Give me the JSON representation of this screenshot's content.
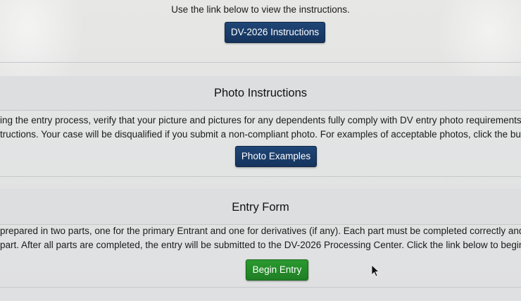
{
  "top_section": {
    "instruction_text": "Use the link below to view the instructions.",
    "button_label": "DV-2026 Instructions"
  },
  "photo_section": {
    "heading": "Photo Instructions",
    "line1": "ing the entry process, verify that your picture and pictures for any dependents fully comply with DV entry photo requirements incluc",
    "line2": "tructions.  Your case will be disqualified if you submit a non-compliant photo.  For examples of acceptable photos, click the button",
    "button_label": "Photo Examples"
  },
  "entry_section": {
    "heading": "Entry Form",
    "line1": " prepared in two parts, one for the primary Entrant and one for derivatives (if any). Each part must be completed correctly and comp",
    "line2": " part. After all parts are completed, the entry will be submitted to the DV-2026 Processing Center. Click the link below to begin the e",
    "button_label": "Begin Entry"
  },
  "colors": {
    "navy_button": "#1a3e6c",
    "green_button": "#24902a"
  },
  "icons": {
    "cursor": "mouse-pointer-icon"
  }
}
